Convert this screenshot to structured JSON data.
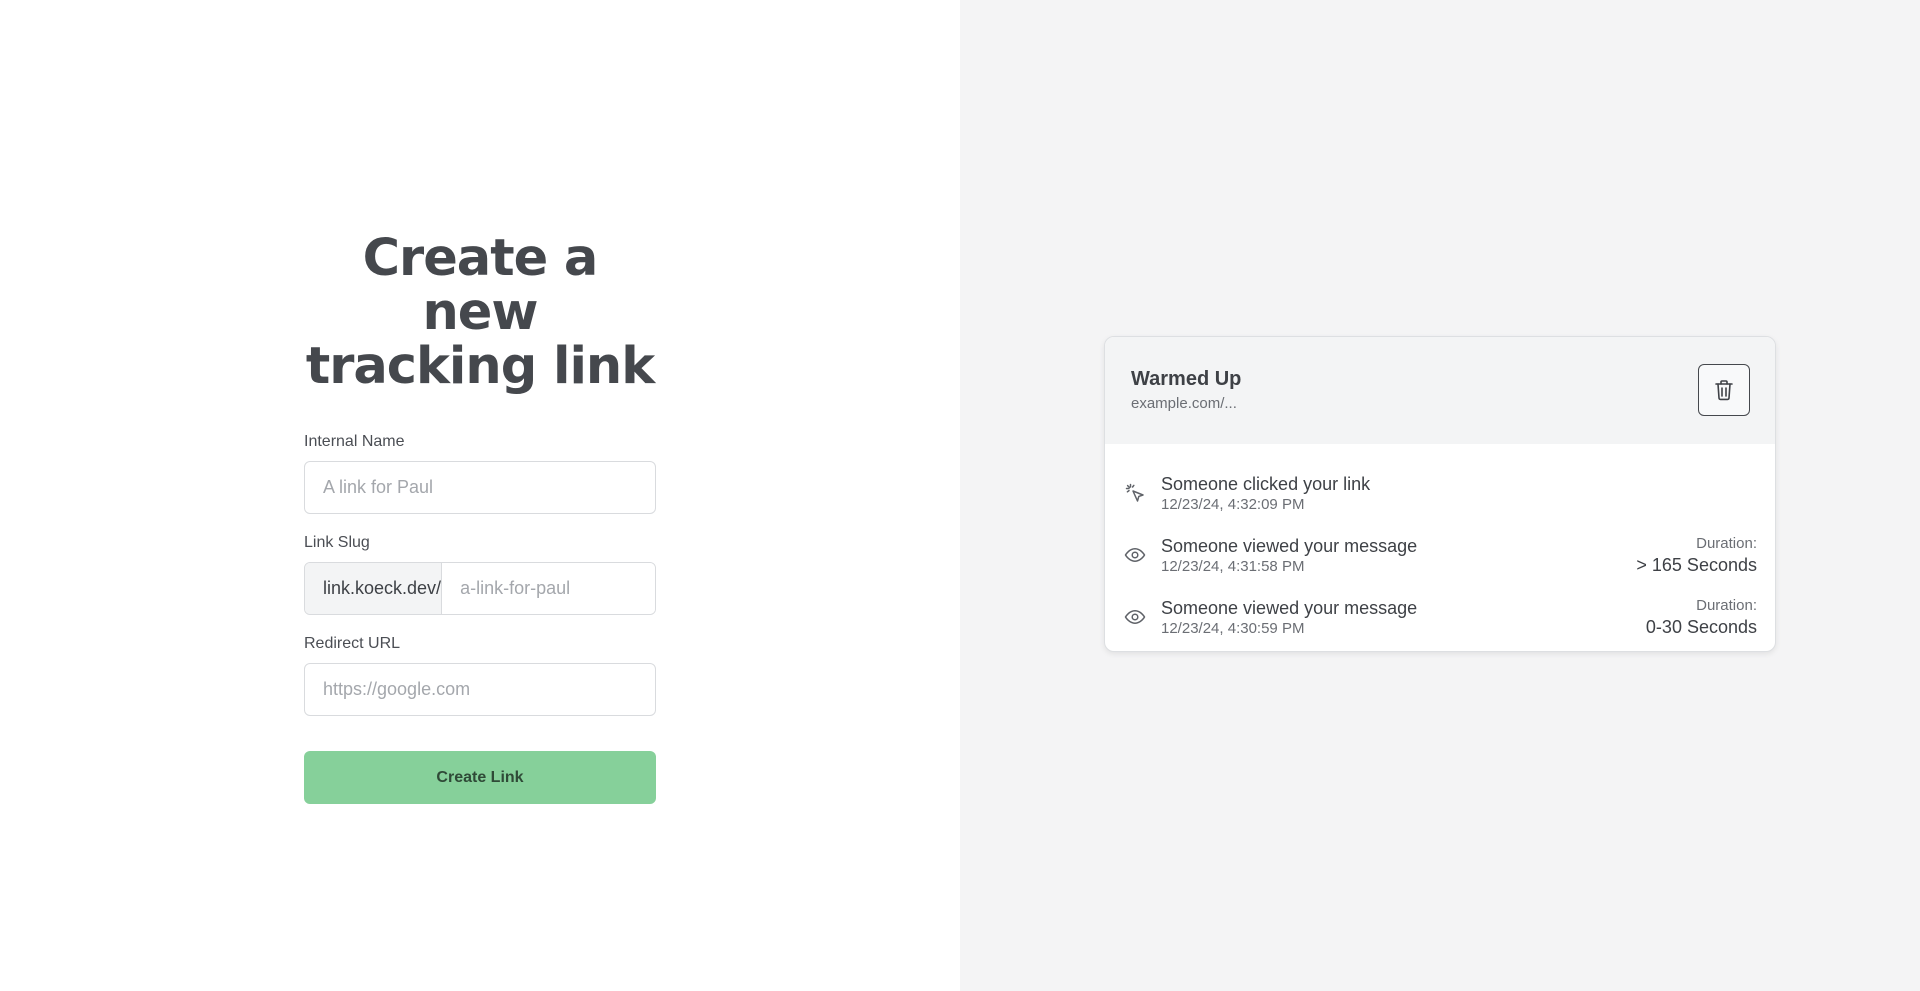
{
  "form": {
    "title_line1": "Create a new",
    "title_line2": "tracking link",
    "internal_name_label": "Internal Name",
    "internal_name_placeholder": "A link for Paul",
    "internal_name_value": "",
    "slug_label": "Link Slug",
    "slug_prefix": "link.koeck.dev/",
    "slug_placeholder": "a-link-for-paul",
    "slug_value": "",
    "redirect_label": "Redirect URL",
    "redirect_placeholder": "https://google.com",
    "redirect_value": "",
    "submit_label": "Create Link"
  },
  "link_card": {
    "title": "Warmed Up",
    "url": "example.com/...",
    "delete_icon": "trash-icon",
    "events": [
      {
        "icon": "pointer-click-icon",
        "title": "Someone clicked your link",
        "time": "12/23/24, 4:32:09 PM",
        "duration_label": "",
        "duration_value": ""
      },
      {
        "icon": "eye-icon",
        "title": "Someone viewed your message",
        "time": "12/23/24, 4:31:58 PM",
        "duration_label": "Duration:",
        "duration_value": "> 165 Seconds"
      },
      {
        "icon": "eye-icon",
        "title": "Someone viewed your message",
        "time": "12/23/24, 4:30:59 PM",
        "duration_label": "Duration:",
        "duration_value": "0-30 Seconds"
      }
    ]
  },
  "colors": {
    "button_green": "#86d09a",
    "right_background": "#f4f4f5",
    "text_dark": "#3e4146"
  }
}
